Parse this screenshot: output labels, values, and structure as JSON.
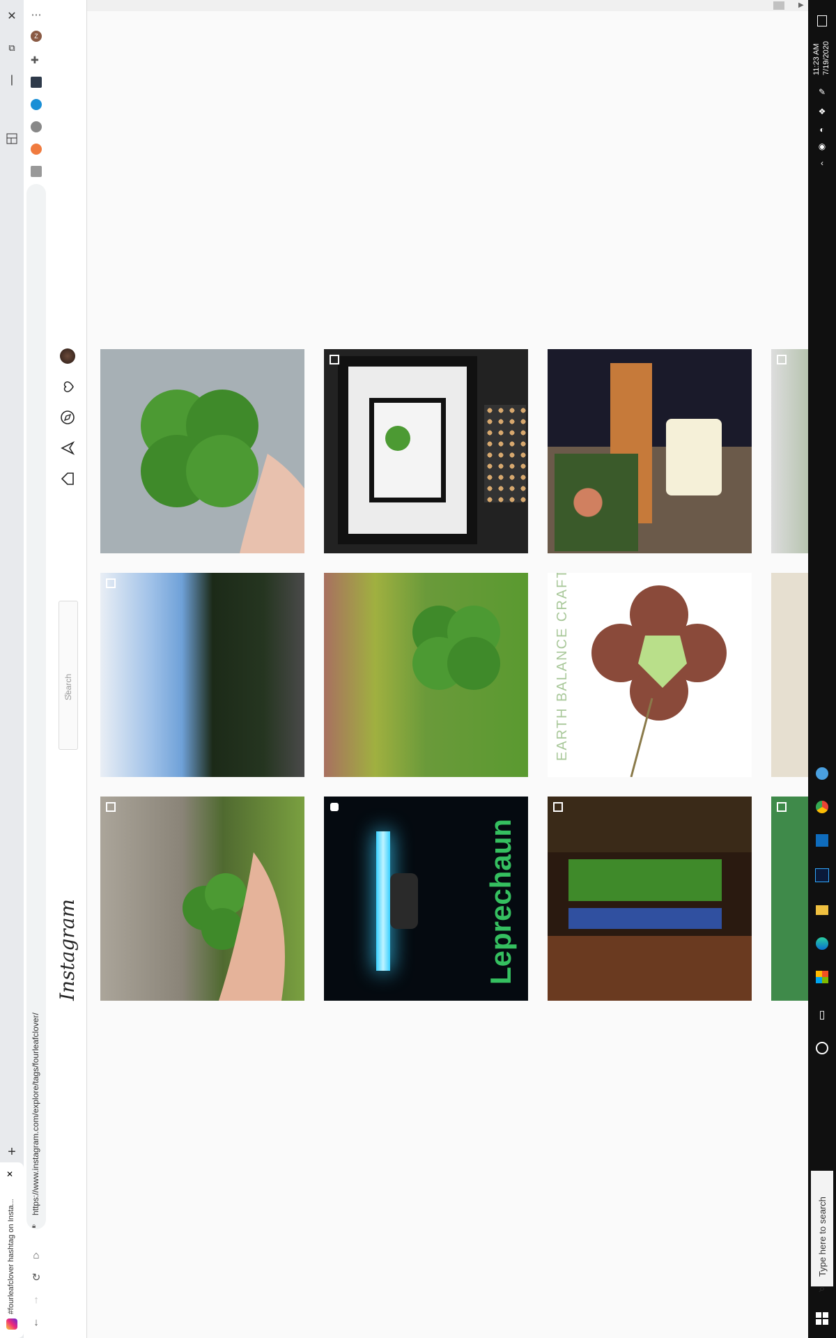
{
  "browser": {
    "tab_title": "#fourleafclover hashtag on Insta...",
    "url": "https://www.instagram.com/explore/tags/fourleafclover/",
    "new_tab_symbol": "+",
    "close_symbol": "✕",
    "menu_symbol": "⋯",
    "profile_initial": "Z"
  },
  "instagram": {
    "logo_text": "Instagram",
    "search_placeholder": "Search"
  },
  "grid": {
    "rows": [
      [
        {
          "desc": "clover-hand",
          "badge": ""
        },
        {
          "desc": "framed-clover",
          "badge": "carousel"
        },
        {
          "desc": "flower-vase",
          "badge": ""
        },
        {
          "desc": "partial",
          "badge": "carousel"
        }
      ],
      [
        {
          "desc": "lake-landscape",
          "badge": "carousel"
        },
        {
          "desc": "clover-closeup",
          "badge": ""
        },
        {
          "desc": "clover-pendant",
          "badge": "",
          "caption": "EARTH BALANCE CRAFT"
        },
        {
          "desc": "partial",
          "badge": ""
        }
      ],
      [
        {
          "desc": "dog-clover",
          "badge": "carousel"
        },
        {
          "desc": "leprechaun",
          "badge": "video",
          "caption": "Leprechaun"
        },
        {
          "desc": "aquarium",
          "badge": "carousel"
        },
        {
          "desc": "partial",
          "badge": "carousel"
        }
      ]
    ]
  },
  "taskbar": {
    "time": "11:23 AM",
    "date": "7/19/2020",
    "search_placeholder": "Type here to search"
  },
  "colors": {
    "ig_bg": "#fafafa",
    "taskbar": "#101010",
    "chrome_strip": "#e8eaed"
  }
}
